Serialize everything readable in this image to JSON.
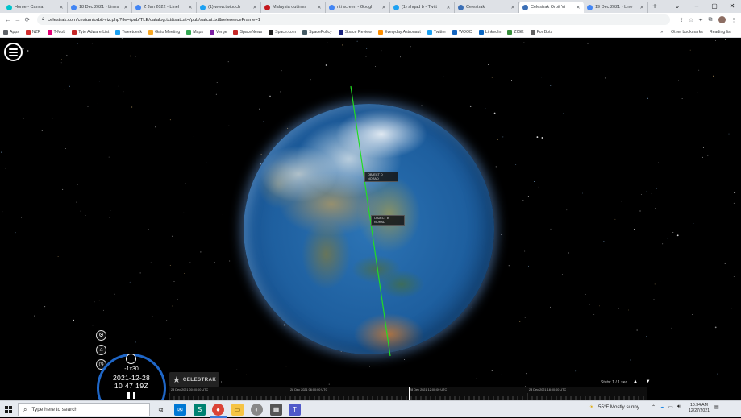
{
  "browser": {
    "tabs": [
      {
        "title": "Home - Canva",
        "color": "#00c4cc",
        "active": false
      },
      {
        "title": "18 Dec 2021 - Lines",
        "color": "#4285f4",
        "active": false
      },
      {
        "title": "Z Jan 2022 - Linel",
        "color": "#4285f4",
        "active": false
      },
      {
        "title": "(1) www.twipuch",
        "color": "#1da1f2",
        "active": false
      },
      {
        "title": "Malaysia outlines",
        "color": "#c4161c",
        "active": false
      },
      {
        "title": "nti screen - Googl",
        "color": "#4285f4",
        "active": false
      },
      {
        "title": "(1) shqad b - Twitt",
        "color": "#1da1f2",
        "active": false
      },
      {
        "title": "Celestrak",
        "color": "#3b6fb6",
        "active": false
      },
      {
        "title": "Celestrak Orbit Vi",
        "color": "#3b6fb6",
        "active": true
      },
      {
        "title": "19 Dec 2021 - Line",
        "color": "#4285f4",
        "active": false
      }
    ],
    "new_tab_label": "+",
    "window_controls": {
      "chevron": "⌄",
      "minimize": "–",
      "maximize": "▢",
      "close": "✕"
    },
    "address": {
      "back_icon": "←",
      "forward_icon": "→",
      "reload_icon": "⟳",
      "url": "celestrak.com/cesium/orbit-viz.php?tle=/pub/TLE/catalog.txt&satcat=/pub/satcat.txt&referenceFrame=1"
    },
    "bookmarks": [
      {
        "label": "Apps",
        "color": "#5f6368"
      },
      {
        "label": "NZR",
        "color": "#d32f2f"
      },
      {
        "label": "T-Mob",
        "color": "#e20074"
      },
      {
        "label": "Tyte Adware List",
        "color": "#c62828"
      },
      {
        "label": "Tweetdeck",
        "color": "#1da1f2"
      },
      {
        "label": "Gato Meeting",
        "color": "#f9a825"
      },
      {
        "label": "Maps",
        "color": "#34a853"
      },
      {
        "label": "Verge",
        "color": "#7b1fa2"
      },
      {
        "label": "SpaceNews",
        "color": "#c62828"
      },
      {
        "label": "Space.com",
        "color": "#212121"
      },
      {
        "label": "SpacePolicy",
        "color": "#455a64"
      },
      {
        "label": "Space Review",
        "color": "#1a237e"
      },
      {
        "label": "Everyday Astronaut",
        "color": "#ff8f00"
      },
      {
        "label": "Twitter",
        "color": "#1da1f2"
      },
      {
        "label": "WOOD",
        "color": "#1565c0"
      },
      {
        "label": "LinkedIn",
        "color": "#0a66c2"
      },
      {
        "label": "ZIGK",
        "color": "#388e3c"
      },
      {
        "label": "For Bots",
        "color": "#616161"
      }
    ],
    "bookmarks_more": "»",
    "bookmarks_right": [
      "Other bookmarks",
      "Reading list"
    ]
  },
  "viewer": {
    "labels": [
      {
        "line1": "OBJECT D",
        "line2": "NORAD"
      },
      {
        "line1": "OBJECT B",
        "line2": "NORAD"
      }
    ],
    "controls": {
      "speed": "-1x30",
      "date": "2021-12-28",
      "time": "10 47 19Z"
    },
    "logo_text": "CELESTRAK",
    "stats_text": "Stats: 1 / 1 sec",
    "stats_arrows": "▲ ▼",
    "timeline_labels": [
      "28 Dec 2021 00:00:00 UTC",
      "28 Dec 2021 06:00:00 UTC",
      "28 Dec 2021 12:00:00 UTC",
      "28 Dec 2021 18:00:00 UTC"
    ],
    "colors": {
      "orbit": "#22dd22",
      "clock_ring": "#1f67c8"
    }
  },
  "taskbar": {
    "search_placeholder": "Type here to search",
    "weather": "55°F  Mostly sunny",
    "time": "10:34 AM",
    "date": "12/27/2021"
  }
}
